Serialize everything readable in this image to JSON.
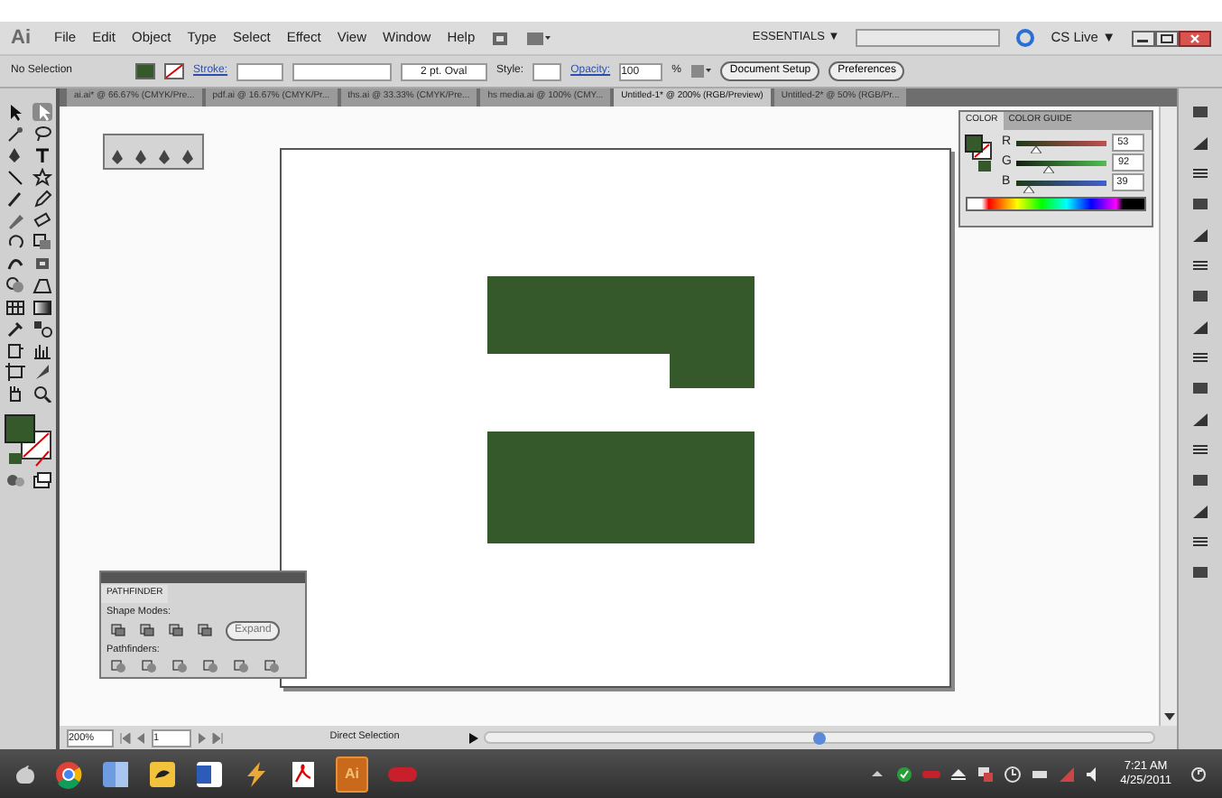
{
  "app_logo": "Ai",
  "menu": [
    "File",
    "Edit",
    "Object",
    "Type",
    "Select",
    "Effect",
    "View",
    "Window",
    "Help"
  ],
  "workspace": {
    "label": "ESSENTIALS",
    "arrow": "▼"
  },
  "cs_live": {
    "label": "CS Live",
    "arrow": "▼"
  },
  "control_bar": {
    "selection": "No Selection",
    "stroke_label": "Stroke:",
    "brush": "2 pt. Oval",
    "style_label": "Style:",
    "opacity_label": "Opacity:",
    "opacity": "100",
    "percent": "%",
    "buttons": [
      "Document Setup",
      "Preferences"
    ]
  },
  "doc_tabs": [
    {
      "label": "ai.ai* @ 66.67% (CMYK/Pre...",
      "selected": false
    },
    {
      "label": "pdf.ai @ 16.67% (CMYK/Pr...",
      "selected": false
    },
    {
      "label": "ths.ai @ 33.33% (CMYK/Pre...",
      "selected": false
    },
    {
      "label": "hs media.ai @ 100% (CMY...",
      "selected": false
    },
    {
      "label": "Untitled-1* @ 200% (RGB/Preview)",
      "selected": true
    },
    {
      "label": "Untitled-2* @ 50% (RGB/Pr...",
      "selected": false
    }
  ],
  "color_panel": {
    "tabs": [
      {
        "label": "COLOR",
        "selected": true
      },
      {
        "label": "COLOR GUIDE",
        "selected": false
      }
    ],
    "channels": [
      {
        "name": "R",
        "level": 0.21,
        "value": "53"
      },
      {
        "name": "G",
        "level": 0.36,
        "value": "92"
      },
      {
        "name": "B",
        "level": 0.15,
        "value": "39"
      }
    ]
  },
  "pathfinder": {
    "title": "PATHFINDER",
    "shape_modes": "Shape Modes:",
    "expand": "Expand",
    "pathfinders": "Pathfinders:"
  },
  "status_bar": {
    "zoom": "200%",
    "page": "1",
    "tool": "Direct Selection"
  },
  "taskbar": {
    "ai_label": "Ai",
    "time": "7:21 AM",
    "date": "4/25/2011"
  }
}
